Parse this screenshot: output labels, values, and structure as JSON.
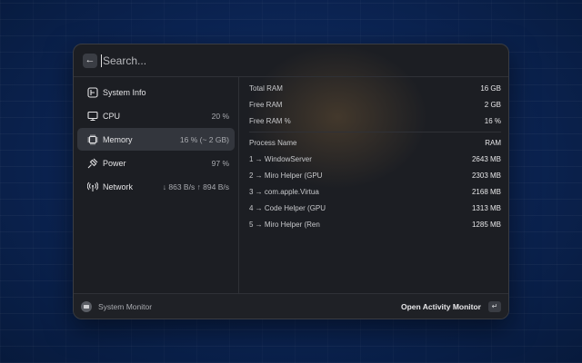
{
  "search": {
    "placeholder": "Search..."
  },
  "sidebar": {
    "items": [
      {
        "label": "System Info",
        "value": ""
      },
      {
        "label": "CPU",
        "value": "20 %"
      },
      {
        "label": "Memory",
        "value": "16 % (~ 2 GB)"
      },
      {
        "label": "Power",
        "value": "97 %"
      },
      {
        "label": "Network",
        "value": "↓ 863 B/s ↑ 894 B/s"
      }
    ],
    "selected_index": 2
  },
  "memory": {
    "stats": [
      {
        "label": "Total RAM",
        "value": "16 GB"
      },
      {
        "label": "Free RAM",
        "value": "2 GB"
      },
      {
        "label": "Free RAM %",
        "value": "16 %"
      }
    ],
    "processes_header": {
      "name": "Process Name",
      "value": "RAM"
    },
    "processes": [
      {
        "name": "1 → WindowServer",
        "value": "2643 MB"
      },
      {
        "name": "2 → Miro Helper (GPU",
        "value": "2303 MB"
      },
      {
        "name": "3 → com.apple.Virtua",
        "value": "2168 MB"
      },
      {
        "name": "4 → Code Helper (GPU",
        "value": "1313 MB"
      },
      {
        "name": "5 → Miro Helper (Ren",
        "value": "1285 MB"
      }
    ]
  },
  "footer": {
    "title": "System Monitor",
    "action": "Open Activity Monitor",
    "enter_key": "↵"
  },
  "back_icon_glyph": "←",
  "colors": {
    "background": "#0b2351",
    "window": "#1c1e23",
    "selected": "#33363d",
    "text": "#e4e4e6",
    "muted": "#a9abb0"
  }
}
